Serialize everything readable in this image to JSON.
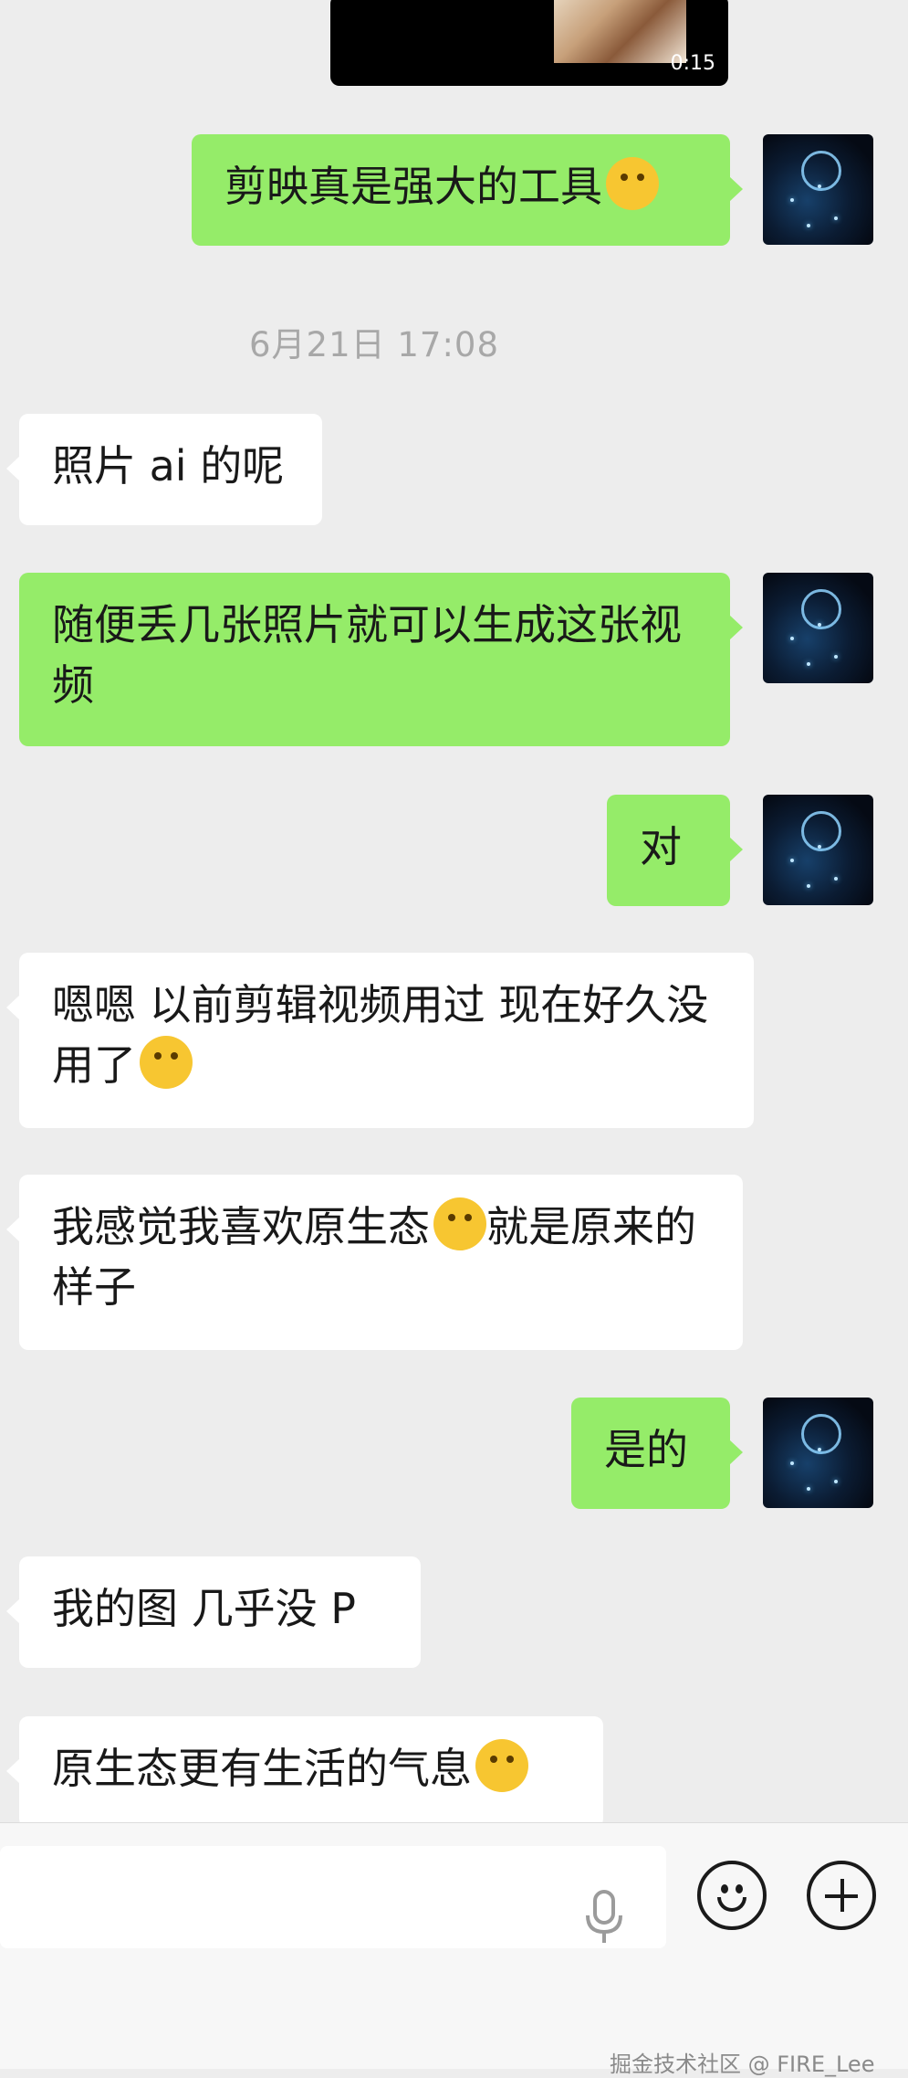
{
  "video": {
    "duration": "0:15"
  },
  "timestamp": "6月21日 17:08",
  "messages": [
    {
      "id": "m1",
      "side": "me",
      "text": "剪映真是强大的工具",
      "emoji": "face-with-tears-of-joy"
    },
    {
      "id": "m2",
      "side": "them",
      "text": "照片 ai 的呢"
    },
    {
      "id": "m3",
      "side": "me",
      "text": "随便丢几张照片就可以生成这张视频"
    },
    {
      "id": "m4",
      "side": "me",
      "text": "对"
    },
    {
      "id": "m5",
      "side": "them",
      "text": "嗯嗯 以前剪辑视频用过 现在好久没用了",
      "emoji": "face-with-hand-over-mouth"
    },
    {
      "id": "m6",
      "side": "them",
      "text_before": "我感觉我喜欢原生态",
      "emoji": "grinning-face",
      "text_after": "就是原来的样子"
    },
    {
      "id": "m7",
      "side": "me",
      "text": "是的"
    },
    {
      "id": "m8",
      "side": "them",
      "text": "我的图 几乎没 P"
    },
    {
      "id": "m9",
      "side": "them",
      "text": "原生态更有生活的气息",
      "emoji": "winking-face-with-tongue"
    }
  ],
  "input_bar": {
    "icons": [
      "microphone-icon",
      "emoji-icon",
      "plus-icon"
    ]
  },
  "watermark": "掘金技术社区 @ FIRE_Lee",
  "colors": {
    "background": "#ededed",
    "my_bubble": "#95ec69",
    "their_bubble": "#ffffff"
  }
}
